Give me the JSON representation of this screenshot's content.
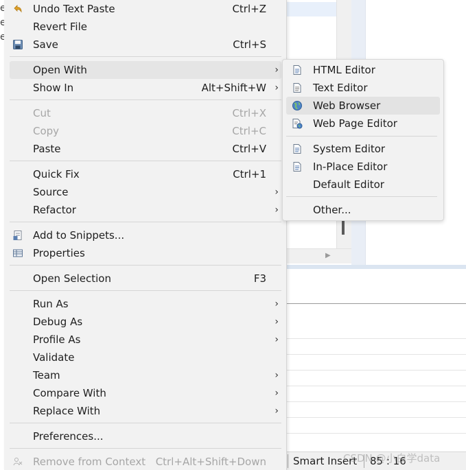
{
  "menu": {
    "undo_label": "Undo Text Paste",
    "undo_shortcut": "Ctrl+Z",
    "revert_label": "Revert File",
    "save_label": "Save",
    "save_shortcut": "Ctrl+S",
    "open_with_label": "Open With",
    "show_in_label": "Show In",
    "show_in_shortcut": "Alt+Shift+W",
    "cut_label": "Cut",
    "cut_shortcut": "Ctrl+X",
    "copy_label": "Copy",
    "copy_shortcut": "Ctrl+C",
    "paste_label": "Paste",
    "paste_shortcut": "Ctrl+V",
    "quick_fix_label": "Quick Fix",
    "quick_fix_shortcut": "Ctrl+1",
    "source_label": "Source",
    "refactor_label": "Refactor",
    "add_snippets_label": "Add to Snippets...",
    "properties_label": "Properties",
    "open_selection_label": "Open Selection",
    "open_selection_shortcut": "F3",
    "run_as_label": "Run As",
    "debug_as_label": "Debug As",
    "profile_as_label": "Profile As",
    "validate_label": "Validate",
    "team_label": "Team",
    "compare_with_label": "Compare With",
    "replace_with_label": "Replace With",
    "preferences_label": "Preferences...",
    "remove_context_label": "Remove from Context",
    "remove_context_shortcut": "Ctrl+Alt+Shift+Down",
    "submenu_arrow": "›"
  },
  "submenu": {
    "html_editor": "HTML Editor",
    "text_editor": "Text Editor",
    "web_browser": "Web Browser",
    "web_page_editor": "Web Page Editor",
    "system_editor": "System Editor",
    "in_place_editor": "In-Place Editor",
    "default_editor": "Default Editor",
    "other": "Other..."
  },
  "statusbar": {
    "insert_mode": "Smart Insert",
    "cursor_position": "85 : 16"
  },
  "watermark": "CSDN @小白学data",
  "background": {
    "edge_letter": "e"
  },
  "colors": {
    "menu_bg": "#f2f2f2",
    "highlight": "#e5e5e5",
    "disabled_text": "#a6a6a6",
    "text": "#1e1e1e"
  }
}
